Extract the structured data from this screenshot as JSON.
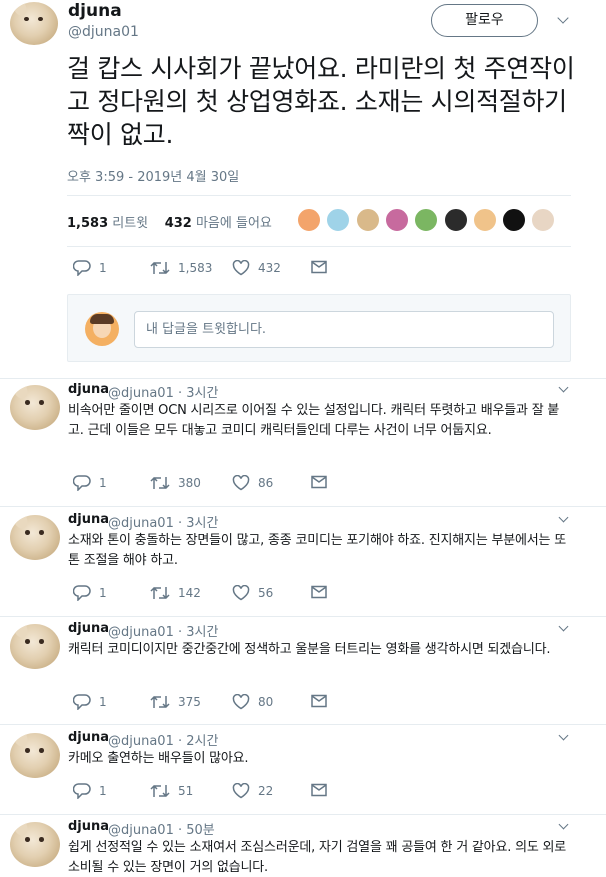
{
  "main_tweet": {
    "name": "djuna",
    "handle": "@djuna01",
    "follow_label": "팔로우",
    "text": "걸 캅스 시사회가 끝났어요. 라미란의 첫 주연작이고 정다원의 첫 상업영화죠. 소재는 시의적절하기 짝이 없고.",
    "time": "오후 3:59 - 2019년 4월 30일",
    "retweets_count": "1,583",
    "retweets_label": "리트윗",
    "likes_count": "432",
    "likes_label": "마음에 들어요",
    "likers": [
      "#f3a46b",
      "#9fd3e8",
      "#d9b98a",
      "#c76a9e",
      "#7bb662",
      "#2b2b2b",
      "#f0c38a",
      "#111111",
      "#e8d6c4"
    ],
    "actions": {
      "reply": "1",
      "retweet": "1,583",
      "like": "432"
    },
    "reply_placeholder": "내 답글을 트윗합니다."
  },
  "replies": [
    {
      "name": "djuna",
      "meta": "@djuna01 · 3시간",
      "text": "비속어만 줄이면 OCN 시리즈로 이어질 수 있는 설정입니다. 캐릭터 뚜렷하고 배우들과 잘 붙고. 근데 이들은 모두 대놓고 코미디 캐릭터들인데 다루는 사건이 너무 어둡지요.",
      "reply": "1",
      "retweet": "380",
      "like": "86"
    },
    {
      "name": "djuna",
      "meta": "@djuna01 · 3시간",
      "text": "소재와 톤이 충돌하는 장면들이 많고, 종종 코미디는 포기해야 하죠. 진지해지는 부분에서는 또 톤 조절을 해야 하고.",
      "reply": "1",
      "retweet": "142",
      "like": "56"
    },
    {
      "name": "djuna",
      "meta": "@djuna01 · 3시간",
      "text": "캐릭터 코미디이지만 중간중간에 정색하고 울분을 터트리는 영화를 생각하시면 되겠습니다.",
      "reply": "1",
      "retweet": "375",
      "like": "80"
    },
    {
      "name": "djuna",
      "meta": "@djuna01 · 2시간",
      "text": "카메오 출연하는 배우들이 많아요.",
      "reply": "1",
      "retweet": "51",
      "like": "22"
    },
    {
      "name": "djuna",
      "meta": "@djuna01 · 50분",
      "text": "쉽게 선정적일 수 있는 소재여서 조심스러운데, 자기 검열을 꽤 공들여 한 거 같아요. 의도 외로 소비될 수 있는 장면이 거의 없습니다.",
      "reply": "",
      "retweet": "",
      "like": ""
    }
  ],
  "icons": [
    "reply-icon",
    "retweet-icon",
    "heart-icon",
    "envelope-icon",
    "chevron-down-icon"
  ]
}
